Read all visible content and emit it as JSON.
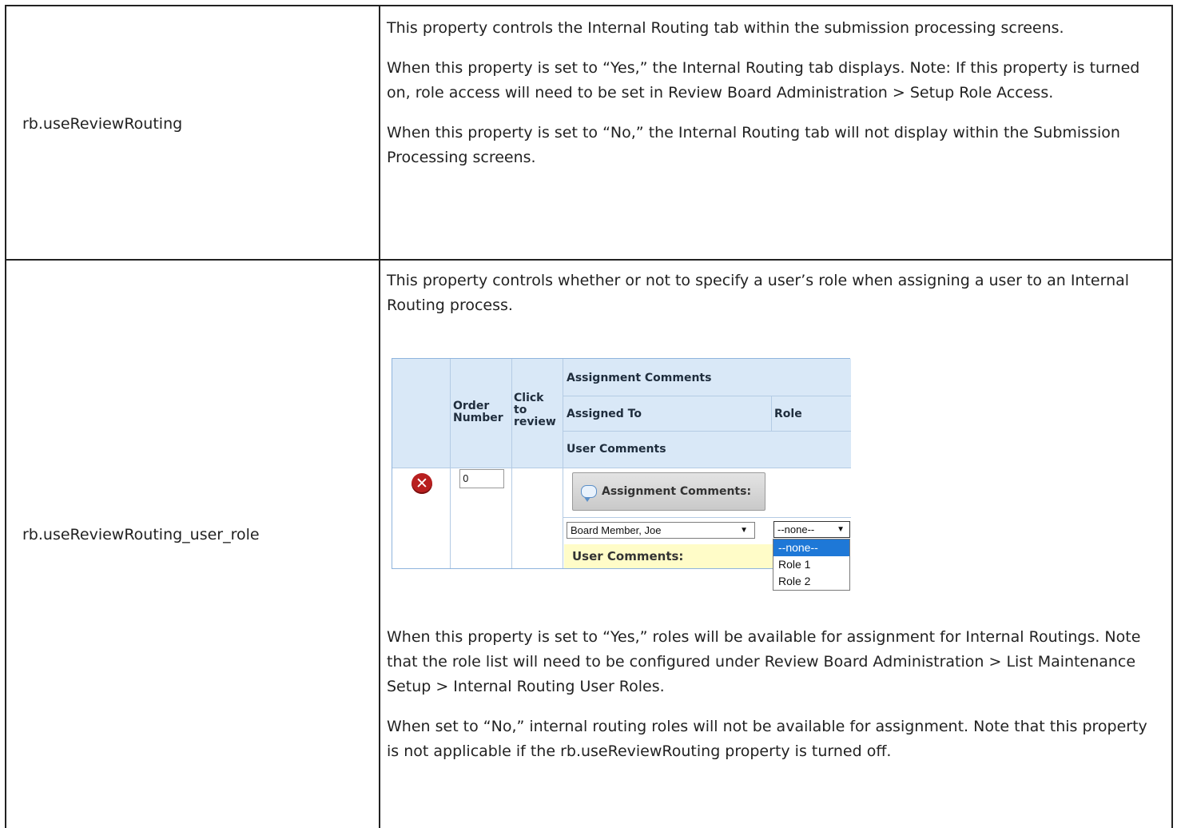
{
  "rows": [
    {
      "property": "rb.useReviewRouting",
      "paragraphs": [
        "This property controls the Internal Routing tab within the submission processing screens.",
        "When this property is set to “Yes,” the Internal Routing tab displays. Note: If this property is turned on, role access will need to be set in Review Board Administration > Setup Role Access.",
        "When this property is set to “No,” the Internal Routing tab will not display within the Submission Processing screens."
      ]
    },
    {
      "property": "rb.useReviewRouting_user_role",
      "intro": "This property controls whether or not to specify a user’s role when assigning a user to an Internal Routing process.",
      "paragraphs": [
        "When this property is set to “Yes,” roles will be available for assignment for Internal Routings. Note that the role list will need to be configured under Review Board Administration > List Maintenance Setup > Internal Routing User Roles.",
        "When set to “No,” internal routing roles will not be available for assignment.  Note that this property is not applicable if the rb.useReviewRouting property is turned off."
      ]
    }
  ],
  "screenshot": {
    "headers": {
      "order_number_1": "Order",
      "order_number_2": "Number",
      "click_1": "Click",
      "click_2": "to",
      "click_3": "review",
      "assignment_comments": "Assignment Comments",
      "assigned_to": "Assigned To",
      "role": "Role",
      "user_comments": "User Comments"
    },
    "order_value": "0",
    "assignment_button": "Assignment Comments:",
    "assigned_to_value": "Board Member, Joe",
    "role_value": "--none--",
    "role_options": [
      "--none--",
      "Role 1",
      "Role 2"
    ],
    "user_comments_label": "User Comments:",
    "delete_icon": "x-circle-icon",
    "comment_icon": "speech-bubble-icon",
    "colors": {
      "header_bg": "#d9e8f7",
      "delete_red": "#b81f1f",
      "selected_option": "#1e78d7",
      "user_comments_bg": "#fffcc8"
    }
  }
}
